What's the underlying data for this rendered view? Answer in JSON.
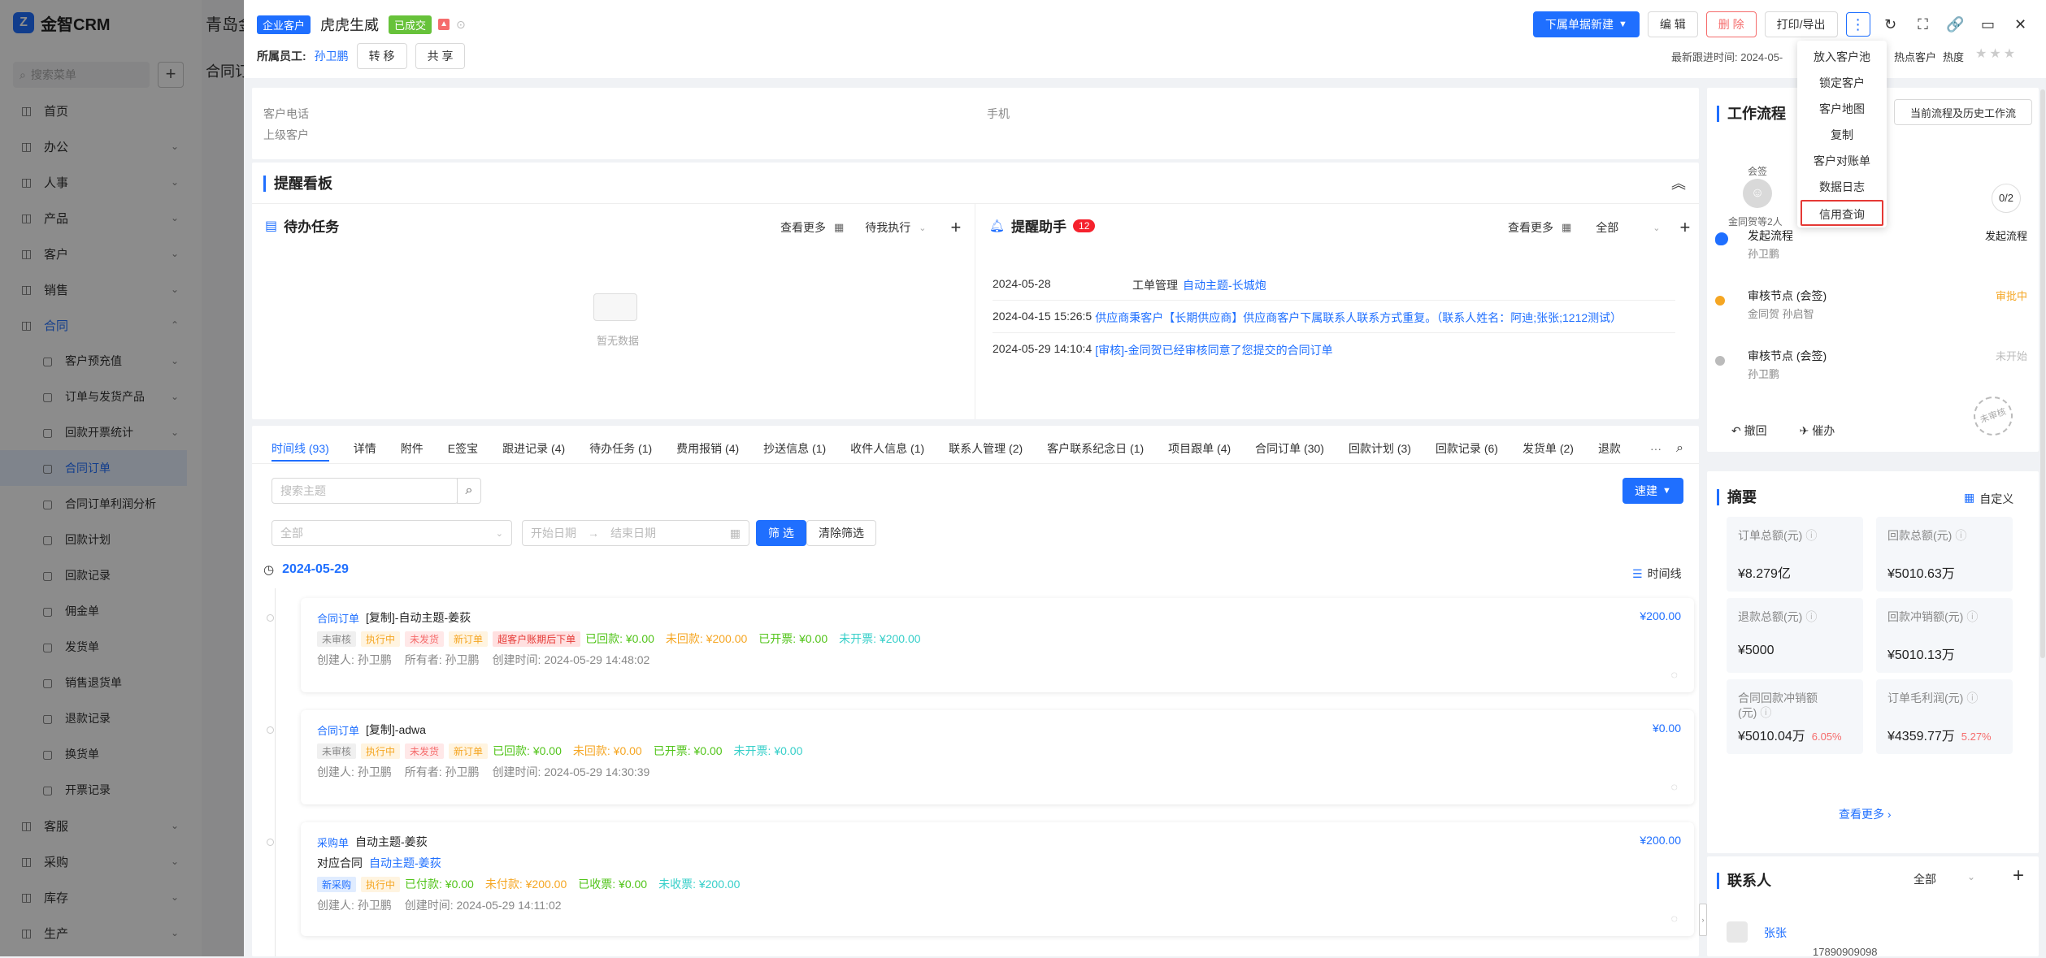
{
  "sidebar": {
    "brand": "金智CRM",
    "search_placeholder": "搜索菜单",
    "items": [
      {
        "label": "首页",
        "icon": "home-icon",
        "sub": false,
        "chev": false
      },
      {
        "label": "办公",
        "icon": "office-icon",
        "sub": false,
        "chev": true
      },
      {
        "label": "人事",
        "icon": "people-icon",
        "sub": false,
        "chev": true
      },
      {
        "label": "产品",
        "icon": "product-icon",
        "sub": false,
        "chev": true
      },
      {
        "label": "客户",
        "icon": "customer-icon",
        "sub": false,
        "chev": true
      },
      {
        "label": "销售",
        "icon": "sales-icon",
        "sub": false,
        "chev": true
      },
      {
        "label": "合同",
        "icon": "contract-icon",
        "sub": false,
        "chev": true,
        "active": true
      },
      {
        "label": "客户预充值",
        "icon": "doc-icon",
        "sub": true,
        "chev": true
      },
      {
        "label": "订单与发货产品",
        "icon": "doc-icon",
        "sub": true,
        "chev": true
      },
      {
        "label": "回款开票统计",
        "icon": "doc-icon",
        "sub": true,
        "chev": true
      },
      {
        "label": "合同订单",
        "icon": "doc-icon",
        "sub": true,
        "chev": false,
        "sel": true
      },
      {
        "label": "合同订单利润分析",
        "icon": "doc-icon",
        "sub": true,
        "chev": false
      },
      {
        "label": "回款计划",
        "icon": "doc-icon",
        "sub": true,
        "chev": false
      },
      {
        "label": "回款记录",
        "icon": "doc-icon",
        "sub": true,
        "chev": false
      },
      {
        "label": "佣金单",
        "icon": "doc-icon",
        "sub": true,
        "chev": false
      },
      {
        "label": "发货单",
        "icon": "doc-icon",
        "sub": true,
        "chev": false
      },
      {
        "label": "销售退货单",
        "icon": "doc-icon",
        "sub": true,
        "chev": false
      },
      {
        "label": "退款记录",
        "icon": "doc-icon",
        "sub": true,
        "chev": false
      },
      {
        "label": "换货单",
        "icon": "doc-icon",
        "sub": true,
        "chev": false
      },
      {
        "label": "开票记录",
        "icon": "doc-icon",
        "sub": true,
        "chev": false
      },
      {
        "label": "客服",
        "icon": "service-icon",
        "sub": false,
        "chev": true
      },
      {
        "label": "采购",
        "icon": "purchase-icon",
        "sub": false,
        "chev": true
      },
      {
        "label": "库存",
        "icon": "stock-icon",
        "sub": false,
        "chev": true
      },
      {
        "label": "生产",
        "icon": "production-icon",
        "sub": false,
        "chev": true
      }
    ],
    "tab1": "青岛金",
    "tab2": "合同订"
  },
  "header": {
    "type_badge": "企业客户",
    "customer_name": "虎虎生威",
    "status_badge": "已成交",
    "owner_label": "所属员工:",
    "owner_name": "孙卫鹏",
    "transfer_btn": "转 移",
    "share_btn": "共 享",
    "new_doc_btn": "下属单据新建",
    "edit_btn": "编 辑",
    "delete_btn": "删 除",
    "print_btn": "打印/导出",
    "last_follow": "最新跟进时间: 2024-05-",
    "hot_label": "热点客户",
    "heat_label": "热度"
  },
  "dropdown": {
    "items": [
      "放入客户池",
      "锁定客户",
      "客户地图",
      "复制",
      "客户对账单",
      "数据日志",
      "信用查询"
    ]
  },
  "info": {
    "phone_label": "客户电话",
    "mobile_label": "手机",
    "parent_label": "上级客户"
  },
  "reminder_board": {
    "title": "提醒看板"
  },
  "tasks": {
    "title": "待办任务",
    "more": "查看更多",
    "filter": "待我执行",
    "empty": "暂无数据"
  },
  "assistant": {
    "title": "提醒助手",
    "count": "12",
    "more": "查看更多",
    "filter": "全部",
    "items": [
      {
        "time": "2024-05-28",
        "prefix": "工单管理",
        "link": "自动主题-长城炮",
        "text": ""
      },
      {
        "time": "2024-04-15 15:26:5",
        "prefix": "",
        "link": "供应商秉客户【长期供应商】供应商客户下属联系人联系方式重复。（联系人姓名：阿迪;张张;1212测试）",
        "text": ""
      },
      {
        "time": "2024-05-29 14:10:4",
        "prefix": "",
        "link": "[审核]-金同贺已经审核同意了您提交的合同订单",
        "text": ""
      }
    ]
  },
  "tabs": {
    "items": [
      "时间线 (93)",
      "详情",
      "附件",
      "E签宝",
      "跟进记录 (4)",
      "待办任务 (1)",
      "费用报销 (4)",
      "抄送信息 (1)",
      "收件人信息 (1)",
      "联系人管理 (2)",
      "客户联系纪念日 (1)",
      "项目跟单 (4)",
      "合同订单 (30)",
      "回款计划 (3)",
      "回款记录 (6)",
      "发货单 (2)",
      "退款"
    ],
    "more": "···"
  },
  "filters": {
    "search_placeholder": "搜索主题",
    "quick_btn": "速建",
    "all_select": "全部",
    "start_date": "开始日期",
    "end_date": "结束日期",
    "filter_btn": "筛 选",
    "clear_btn": "清除筛选"
  },
  "timeline": {
    "date": "2024-05-29",
    "view_label": "时间线",
    "cards": [
      {
        "type": "合同订单",
        "title": "[复制]-自动主题-姜荻",
        "amount": "¥200.00",
        "tags": [
          [
            "未审核",
            "t-gray"
          ],
          [
            "执行中",
            "t-orange"
          ],
          [
            "未发货",
            "t-red"
          ],
          [
            "新订单",
            "t-orange"
          ],
          [
            "超客户账期后下单",
            "t-pink"
          ]
        ],
        "amounts": [
          [
            "已回款: ¥0.00",
            "#52c41a"
          ],
          [
            "未回款: ¥200.00",
            "#f5a623"
          ],
          [
            "已开票: ¥0.00",
            "#52c41a"
          ],
          [
            "未开票: ¥200.00",
            "#36cfc9"
          ]
        ],
        "meta": [
          "创建人: 孙卫鹏",
          "所有者: 孙卫鹏",
          "创建时间: 2024-05-29 14:48:02"
        ]
      },
      {
        "type": "合同订单",
        "title": "[复制]-adwa",
        "amount": "¥0.00",
        "tags": [
          [
            "未审核",
            "t-gray"
          ],
          [
            "执行中",
            "t-orange"
          ],
          [
            "未发货",
            "t-red"
          ],
          [
            "新订单",
            "t-orange"
          ]
        ],
        "amounts": [
          [
            "已回款: ¥0.00",
            "#52c41a"
          ],
          [
            "未回款: ¥0.00",
            "#f5a623"
          ],
          [
            "已开票: ¥0.00",
            "#52c41a"
          ],
          [
            "未开票: ¥0.00",
            "#36cfc9"
          ]
        ],
        "meta": [
          "创建人: 孙卫鹏",
          "所有者: 孙卫鹏",
          "创建时间: 2024-05-29 14:30:39"
        ]
      },
      {
        "type": "采购单",
        "title": "自动主题-姜荻",
        "amount": "¥200.00",
        "related_label": "对应合同",
        "related_link": "自动主题-姜荻",
        "tags": [
          [
            "新采购",
            "t-blue"
          ],
          [
            "执行中",
            "t-orange"
          ]
        ],
        "amounts": [
          [
            "已付款: ¥0.00",
            "#52c41a"
          ],
          [
            "未付款: ¥200.00",
            "#f5a623"
          ],
          [
            "已收票: ¥0.00",
            "#52c41a"
          ],
          [
            "未收票: ¥200.00",
            "#36cfc9"
          ]
        ],
        "meta": [
          "创建人: 孙卫鹏",
          "创建时间: 2024-05-29 14:11:02"
        ]
      }
    ]
  },
  "workflow": {
    "title": "工作流程",
    "history_btn": "当前流程及历史工作流",
    "sign_label": "会签",
    "sign_people": "金同贺等2人",
    "progress": "0/2",
    "steps": [
      {
        "name": "发起流程",
        "person": "孙卫鹏",
        "status": "发起流程",
        "color": "#1f6fff"
      },
      {
        "name": "审核节点 (会签)",
        "person": "金同贺 孙启智",
        "status": "审批中",
        "color": "#f5a623"
      },
      {
        "name": "审核节点 (会签)",
        "person": "孙卫鹏",
        "status": "未开始",
        "color": "#bbb"
      }
    ],
    "undo": "撤回",
    "urge": "催办",
    "stamp": "未审核"
  },
  "summary": {
    "title": "摘要",
    "custom": "自定义",
    "cards": [
      {
        "label": "订单总额(元)",
        "value": "¥8.279亿",
        "pct": ""
      },
      {
        "label": "回款总额(元)",
        "value": "¥5010.63万",
        "pct": ""
      },
      {
        "label": "退款总额(元)",
        "value": "¥5000",
        "pct": ""
      },
      {
        "label": "回款冲销额(元)",
        "value": "¥5010.13万",
        "pct": ""
      },
      {
        "label": "合同回款冲销额(元)",
        "value": "¥5010.04万",
        "pct": "6.05%"
      },
      {
        "label": "订单毛利润(元)",
        "value": "¥4359.77万",
        "pct": "5.27%"
      }
    ],
    "more": "查看更多"
  },
  "contacts": {
    "title": "联系人",
    "filter": "全部",
    "name": "张张",
    "phone": "17890909098"
  },
  "colors": {
    "primary": "#1f6fff",
    "danger": "#f56c6c",
    "warning": "#f5a623",
    "success": "#52c41a"
  }
}
